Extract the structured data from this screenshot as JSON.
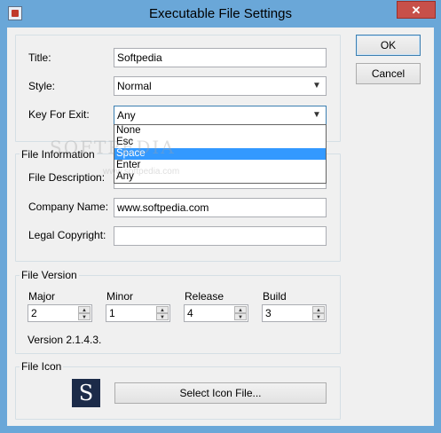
{
  "window": {
    "title": "Executable File Settings",
    "close_glyph": "✕"
  },
  "buttons": {
    "ok": "OK",
    "cancel": "Cancel",
    "select_icon": "Select Icon File..."
  },
  "general": {
    "title_label": "Title:",
    "title_value": "Softpedia",
    "style_label": "Style:",
    "style_value": "Normal",
    "key_label": "Key For Exit:",
    "key_value": "Any",
    "key_options": [
      "None",
      "Esc",
      "Space",
      "Enter",
      "Any"
    ],
    "key_highlighted": "Space"
  },
  "file_info": {
    "group_title": "File Information",
    "description_label": "File Description:",
    "description_value": "",
    "company_label": "Company Name:",
    "company_value": "www.softpedia.com",
    "copyright_label": "Legal Copyright:",
    "copyright_value": ""
  },
  "file_version": {
    "group_title": "File Version",
    "major_label": "Major",
    "major_value": "2",
    "minor_label": "Minor",
    "minor_value": "1",
    "release_label": "Release",
    "release_value": "4",
    "build_label": "Build",
    "build_value": "3",
    "version_text": "Version 2.1.4.3."
  },
  "file_icon": {
    "group_title": "File Icon",
    "icon_letter": "S"
  },
  "watermark": {
    "main": "SOFTPEDIA",
    "sub": "www.softpedia.com"
  },
  "colors": {
    "titlebar": "#6aa7d8",
    "close": "#c7504a",
    "selection": "#3399ff",
    "icon_bg": "#1c2b49"
  }
}
